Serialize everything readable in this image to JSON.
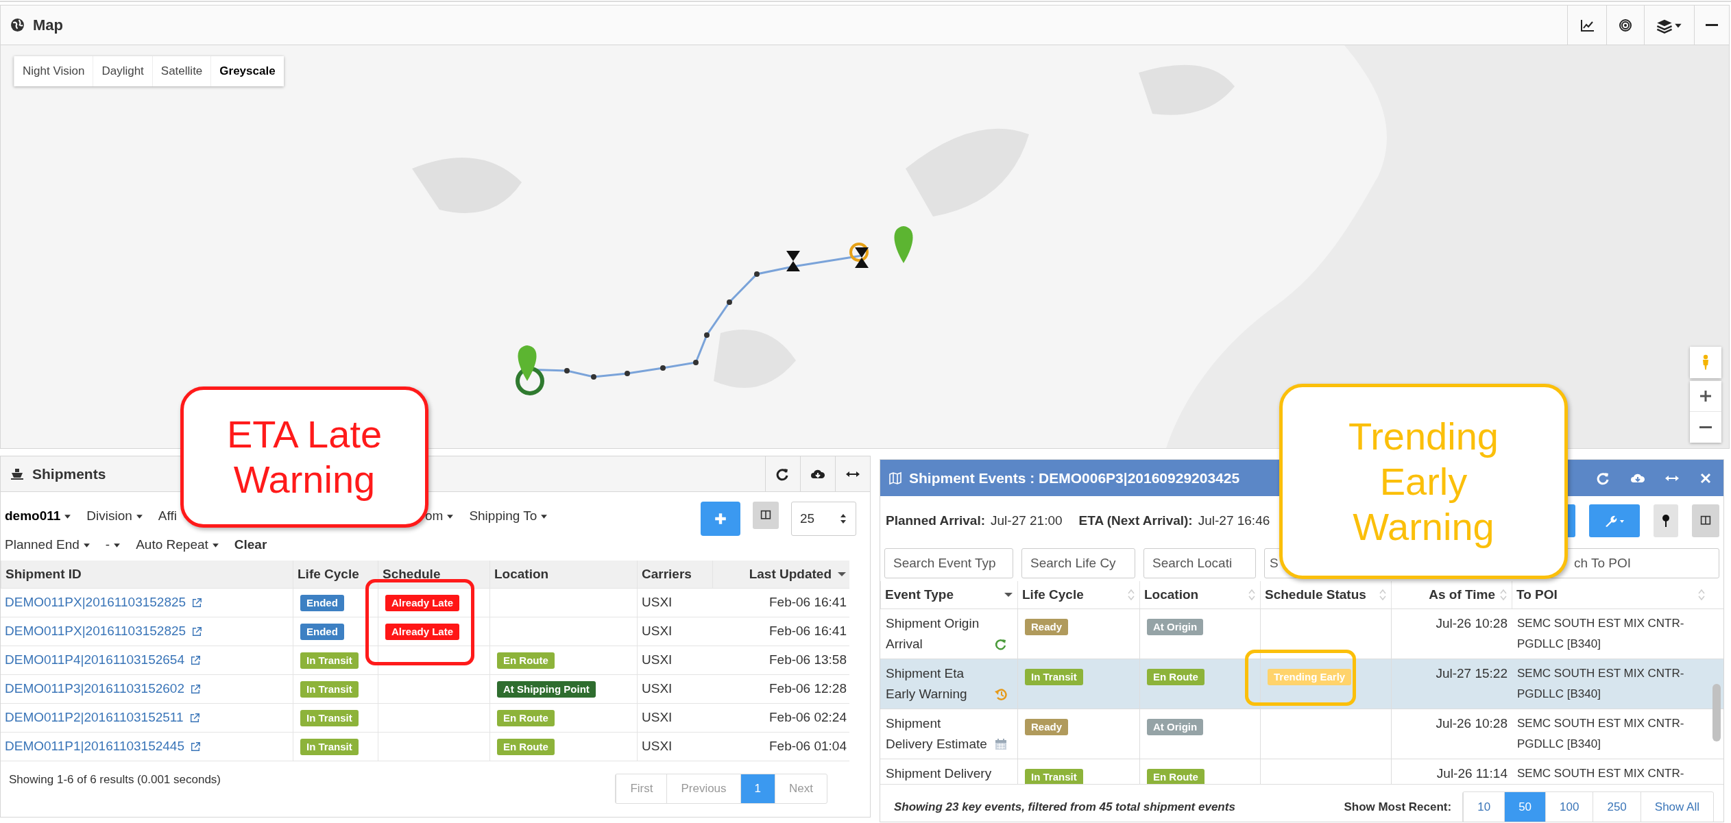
{
  "map": {
    "title": "Map",
    "style_buttons": [
      {
        "label": "Night Vision",
        "selected": false
      },
      {
        "label": "Daylight",
        "selected": false
      },
      {
        "label": "Satellite",
        "selected": false
      },
      {
        "label": "Greyscale",
        "selected": true
      }
    ]
  },
  "shipments": {
    "title": "Shipments",
    "filter_rows": [
      [
        {
          "label": "demo011",
          "kind": "account"
        },
        {
          "label": "Division",
          "kind": "dropdown"
        },
        {
          "label": "Affi",
          "kind": "partial"
        },
        {
          "label": "om",
          "kind": "dropdown"
        },
        {
          "label": "Shipping To",
          "kind": "dropdown"
        }
      ],
      [
        {
          "label": "Planned End",
          "kind": "dropdown"
        },
        {
          "label": "-",
          "kind": "dropdown"
        },
        {
          "label": "Auto Repeat",
          "kind": "dropdown"
        },
        {
          "label": "Clear",
          "kind": "action"
        }
      ]
    ],
    "page_size": "25",
    "columns": [
      {
        "label": "Shipment ID",
        "sorted": false
      },
      {
        "label": "Life Cycle",
        "sorted": false
      },
      {
        "label": "Schedule",
        "sorted": false
      },
      {
        "label": "Location",
        "sorted": false
      },
      {
        "label": "Carriers",
        "sorted": false
      },
      {
        "label": "Last Updated",
        "sorted": true
      }
    ],
    "rows": [
      {
        "id": "DEMO011PX|20161103152825",
        "life_cycle": {
          "text": "Ended",
          "color": "#3d80c3"
        },
        "schedule": {
          "text": "Already Late",
          "color": "#ff1616"
        },
        "carrier": "USXI",
        "last_updated": "Feb-06 16:41"
      },
      {
        "id": "DEMO011PX|20161103152825",
        "life_cycle": {
          "text": "Ended",
          "color": "#3d80c3"
        },
        "schedule": {
          "text": "Already Late",
          "color": "#ff1616"
        },
        "carrier": "USXI",
        "last_updated": "Feb-06 16:41"
      },
      {
        "id": "DEMO011P4|20161103152654",
        "life_cycle": {
          "text": "In Transit",
          "color": "#8db33a"
        },
        "location": {
          "text": "En Route",
          "color": "#8db33a"
        },
        "carrier": "USXI",
        "last_updated": "Feb-06 13:58"
      },
      {
        "id": "DEMO011P3|20161103152602",
        "life_cycle": {
          "text": "In Transit",
          "color": "#8db33a"
        },
        "location": {
          "text": "At Shipping Point",
          "color": "#2f6d2f"
        },
        "carrier": "USXI",
        "last_updated": "Feb-06 12:28"
      },
      {
        "id": "DEMO011P2|20161103152511",
        "life_cycle": {
          "text": "In Transit",
          "color": "#8db33a"
        },
        "location": {
          "text": "En Route",
          "color": "#8db33a"
        },
        "carrier": "USXI",
        "last_updated": "Feb-06 02:24"
      },
      {
        "id": "DEMO011P1|20161103152445",
        "life_cycle": {
          "text": "In Transit",
          "color": "#8db33a"
        },
        "location": {
          "text": "En Route",
          "color": "#8db33a"
        },
        "carrier": "USXI",
        "last_updated": "Feb-06 01:04"
      }
    ],
    "footer": "Showing 1-6 of 6 results (0.001 seconds)",
    "pagination": [
      {
        "label": "First",
        "selected": false
      },
      {
        "label": "Previous",
        "selected": false
      },
      {
        "label": "1",
        "selected": true
      },
      {
        "label": "Next",
        "selected": false
      }
    ]
  },
  "events": {
    "title": "Shipment Events : DEMO006P3|20160929203425",
    "planned_arrival_label": "Planned Arrival:",
    "planned_arrival": "Jul-27 21:00",
    "eta_label": "ETA (Next Arrival):",
    "eta": "Jul-27 16:46",
    "search_placeholders": [
      "Search Event Typ",
      "Search Life Cy",
      "Search Locati",
      "S",
      "ch To POI"
    ],
    "columns": [
      {
        "label": "Event Type",
        "sorted": true
      },
      {
        "label": "Life Cycle",
        "sorted": false
      },
      {
        "label": "Location",
        "sorted": false
      },
      {
        "label": "Schedule Status",
        "sorted": false
      },
      {
        "label": "As of Time",
        "sorted": false
      },
      {
        "label": "To POI",
        "sorted": false
      }
    ],
    "rows": [
      {
        "event_type": "Shipment Origin Arrival",
        "kind": "arrival",
        "life_cycle": {
          "text": "Ready",
          "color": "#b09a5c"
        },
        "location": {
          "text": "At Origin",
          "color": "#95a3a6"
        },
        "as_of_time": "Jul-26 10:28",
        "to_poi": "SEMC SOUTH EST MIX CNTR-PGDLLC [B340]",
        "selected": false
      },
      {
        "event_type": "Shipment Eta Early Warning",
        "kind": "warning",
        "life_cycle": {
          "text": "In Transit",
          "color": "#8db33a"
        },
        "location": {
          "text": "En Route",
          "color": "#8db33a"
        },
        "schedule_status": {
          "text": "Trending Early",
          "color": "#ffd36b"
        },
        "as_of_time": "Jul-27 15:22",
        "to_poi": "SEMC SOUTH EST MIX CNTR-PGDLLC [B340]",
        "selected": true
      },
      {
        "event_type": "Shipment Delivery Estimate",
        "kind": "estimate",
        "life_cycle": {
          "text": "Ready",
          "color": "#b09a5c"
        },
        "location": {
          "text": "At Origin",
          "color": "#95a3a6"
        },
        "as_of_time": "Jul-26 10:28",
        "to_poi": "SEMC SOUTH EST MIX CNTR-PGDLLC [B340]",
        "selected": false
      },
      {
        "event_type": "Shipment Delivery",
        "kind": "delivery",
        "life_cycle": {
          "text": "In Transit",
          "color": "#8db33a"
        },
        "location": {
          "text": "En Route",
          "color": "#8db33a"
        },
        "as_of_time": "Jul-26 11:14",
        "to_poi": "SEMC SOUTH EST MIX CNTR-",
        "selected": false
      }
    ],
    "footer": "Showing 23 key events, filtered from 45 total shipment events",
    "show_most_recent_label": "Show Most Recent:",
    "show_most_recent": [
      {
        "label": "10",
        "selected": false
      },
      {
        "label": "50",
        "selected": true
      },
      {
        "label": "100",
        "selected": false
      },
      {
        "label": "250",
        "selected": false
      },
      {
        "label": "Show All",
        "selected": false
      }
    ]
  },
  "callouts": [
    {
      "text": "ETA Late Warning",
      "color": "#ff1a1a"
    },
    {
      "text": "Trending Early Warning",
      "color": "#fbbf0a"
    }
  ],
  "highlights": [
    {
      "color": "#ff1a1a"
    },
    {
      "color": "#fbbf0a"
    }
  ]
}
